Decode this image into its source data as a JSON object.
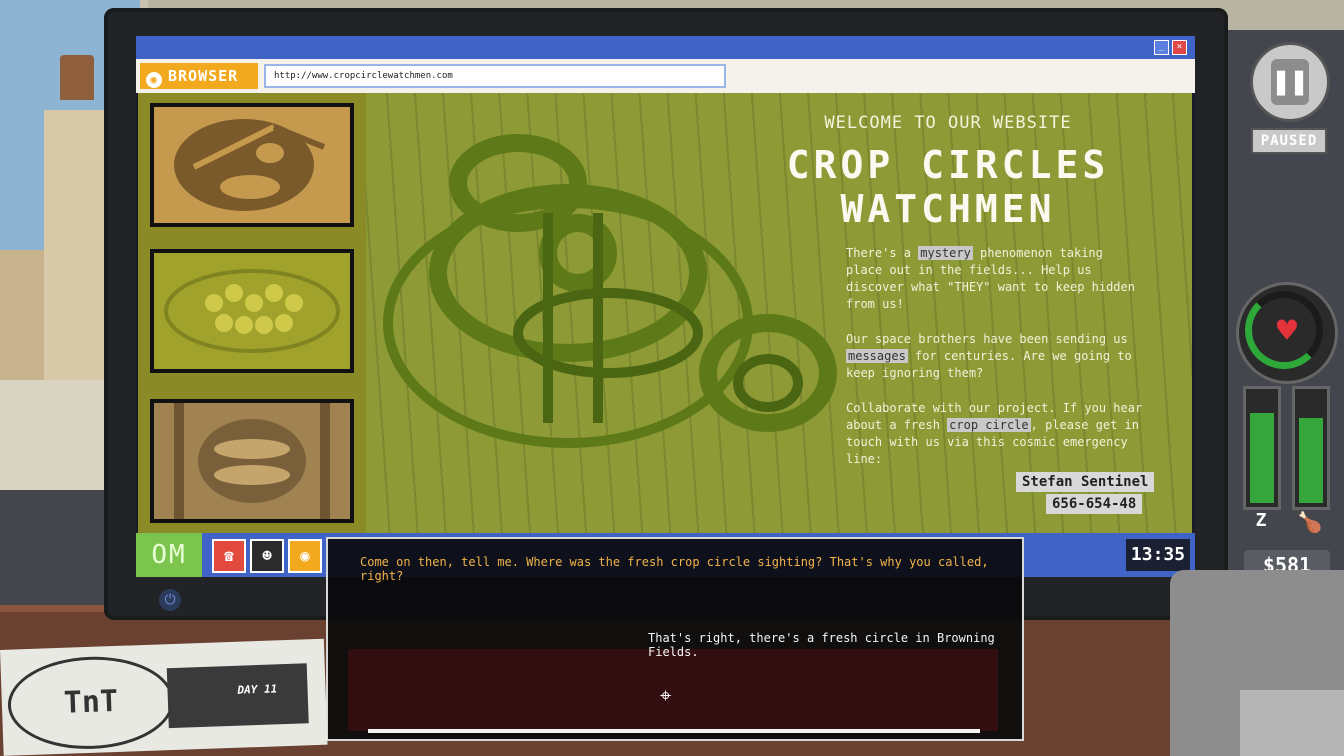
{
  "browser": {
    "label": "BROWSER",
    "url": "http://www.cropcirclewatchmen.com"
  },
  "website": {
    "welcome": "WELCOME TO OUR WEBSITE",
    "title_line1": "CROP CIRCLES",
    "title_line2": "WATCHMEN",
    "p1_a": "There's a ",
    "p1_hl": "mystery",
    "p1_b": " phenomenon taking place out in the fields... Help us discover what \"THEY\" want to keep hidden from us!",
    "p2_a": "Our space brothers have been sending us ",
    "p2_hl": "messages",
    "p2_b": " for centuries. Are we going to keep ignoring them?",
    "p3_a": "Collaborate with our project. If you hear about a fresh ",
    "p3_hl": "crop circle",
    "p3_b": ", please get in touch with us via this cosmic emergency line:",
    "contact_name": "Stefan Sentinel",
    "contact_phone": "656-654-48"
  },
  "taskbar": {
    "start_label": "OM",
    "clock": "13:35"
  },
  "dialog": {
    "npc_line": "Come on then, tell me. Where was the fresh crop circle sighting? That's why you called, right?",
    "player_line": "That's right, there's a fresh circle in Browning Fields."
  },
  "newspaper": {
    "logo": "TnT",
    "day": "DAY 11"
  },
  "hud": {
    "paused": "PAUSED",
    "money": "$581",
    "sleep_icon": "Z",
    "sleep_level": 0.76,
    "hunger_level": 0.72,
    "heart_level": 0.7
  },
  "colors": {
    "window_titlebar": "#3f63c6",
    "browser_accent": "#f3a91d",
    "field_green": "#8d9a36",
    "dialog_npc_text": "#f2b24a",
    "health_green": "#34a63c"
  },
  "icons": [
    "pause-icon",
    "heart-icon",
    "sleep-icon",
    "food-icon",
    "phone-icon",
    "face-icon",
    "browser-icon",
    "power-icon",
    "cursor-icon"
  ]
}
